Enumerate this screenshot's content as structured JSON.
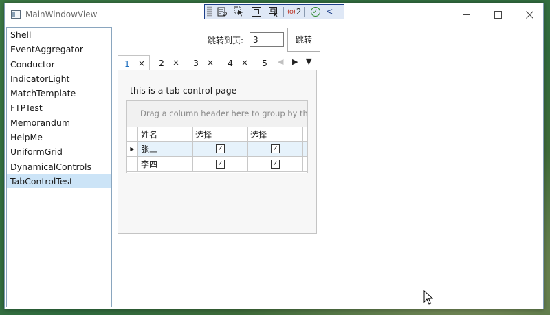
{
  "window": {
    "title": "MainWindowView"
  },
  "devtools": {
    "binding_count": "2",
    "binding_icon": "(o)"
  },
  "sidebar": {
    "items": [
      {
        "label": "Shell"
      },
      {
        "label": "EventAggregator"
      },
      {
        "label": "Conductor"
      },
      {
        "label": "IndicatorLight"
      },
      {
        "label": "MatchTemplate"
      },
      {
        "label": "FTPTest"
      },
      {
        "label": "Memorandum"
      },
      {
        "label": "HelpMe"
      },
      {
        "label": "UniformGrid"
      },
      {
        "label": "DynamicalControls"
      },
      {
        "label": "TabControlTest"
      }
    ],
    "selected_index": 10
  },
  "pager": {
    "label": "跳转到页:",
    "value": "3",
    "button_label": "跳转"
  },
  "tabs": [
    {
      "label": "1"
    },
    {
      "label": "2"
    },
    {
      "label": "3"
    },
    {
      "label": "4"
    },
    {
      "label": "5"
    }
  ],
  "tab_close_glyph": "×",
  "tab_content": {
    "text": "this is a tab control page",
    "group_panel_text": "Drag a column header here to group by tha...",
    "columns": [
      "姓名",
      "选择",
      "选择"
    ],
    "rows": [
      {
        "name": "张三",
        "check1": true,
        "check2": true,
        "selected": true
      },
      {
        "name": "李四",
        "check1": true,
        "check2": true,
        "selected": false
      }
    ]
  },
  "colors": {
    "accent": "#1e6fbf",
    "selection": "#cce4f7",
    "devbar_border": "#1d3f8a"
  }
}
